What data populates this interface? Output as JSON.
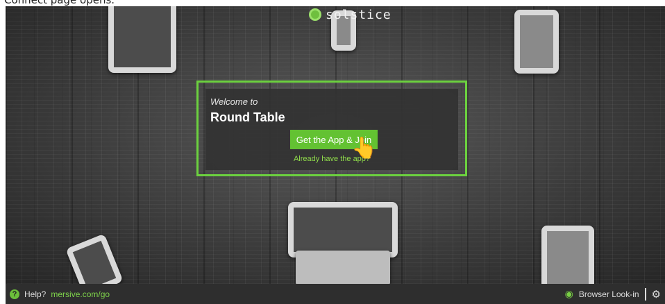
{
  "caption": "Connect page opens.",
  "logo": {
    "text": "solstice"
  },
  "card": {
    "welcome": "Welcome to",
    "room": "Round Table",
    "join_button": "Get the App & Join",
    "already_link": "Already have the app?"
  },
  "footer": {
    "help_label": "Help?",
    "help_link": "mersive.com/go",
    "look_in": "Browser Look-in"
  },
  "icons": {
    "logo": "solstice-logo-icon",
    "help": "question-circle-icon",
    "look_in": "eye-icon",
    "settings": "gear-icon",
    "cursor": "hand-pointer-icon"
  },
  "colors": {
    "accent_green": "#63c232",
    "highlight_green": "#6cd13f",
    "footer_bg": "#2e2e2e"
  }
}
